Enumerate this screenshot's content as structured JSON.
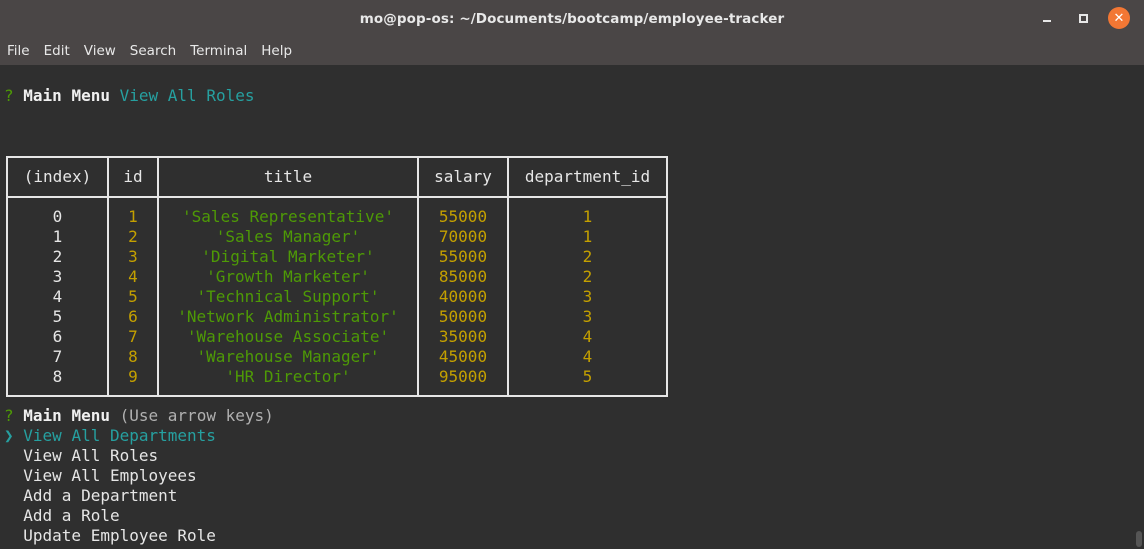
{
  "window": {
    "title": "mo@pop-os: ~/Documents/bootcamp/employee-tracker",
    "minimize_glyph": "",
    "close_glyph": "✕"
  },
  "menubar": [
    "File",
    "Edit",
    "View",
    "Search",
    "Terminal",
    "Help"
  ],
  "prompt1": {
    "mark": "?",
    "label": "Main Menu",
    "answer": "View All Roles"
  },
  "table": {
    "headers": [
      "(index)",
      "id",
      "title",
      "salary",
      "department_id"
    ],
    "rows": [
      [
        "0",
        "1",
        "'Sales Representative'",
        "55000",
        "1"
      ],
      [
        "1",
        "2",
        "'Sales Manager'",
        "70000",
        "1"
      ],
      [
        "2",
        "3",
        "'Digital Marketer'",
        "55000",
        "2"
      ],
      [
        "3",
        "4",
        "'Growth Marketer'",
        "85000",
        "2"
      ],
      [
        "4",
        "5",
        "'Technical Support'",
        "40000",
        "3"
      ],
      [
        "5",
        "6",
        "'Network Administrator'",
        "50000",
        "3"
      ],
      [
        "6",
        "7",
        "'Warehouse Associate'",
        "35000",
        "4"
      ],
      [
        "7",
        "8",
        "'Warehouse Manager'",
        "45000",
        "4"
      ],
      [
        "8",
        "9",
        "'HR Director'",
        "95000",
        "5"
      ]
    ]
  },
  "prompt2": {
    "mark": "?",
    "label": "Main Menu",
    "hint": "(Use arrow keys)"
  },
  "menu": {
    "pointer": "❯",
    "selected": "View All Departments",
    "options": [
      "View All Roles",
      "View All Employees",
      "Add a Department",
      "Add a Role",
      "Update Employee Role"
    ]
  },
  "colors": {
    "titlebar": "#4a4646",
    "terminal_bg": "#2f2f2f",
    "close_button": "#f27734",
    "cyan": "#26a0a0",
    "green": "#4e9a06",
    "yellow": "#c4a000"
  }
}
